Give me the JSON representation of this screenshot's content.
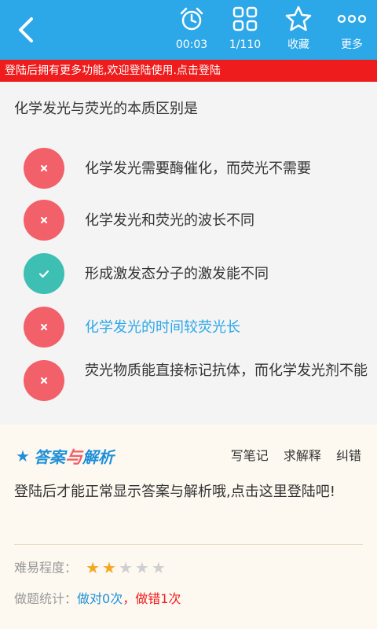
{
  "toolbar": {
    "timer": "00:03",
    "progress": "1/110",
    "favorite_label": "收藏",
    "more_label": "更多"
  },
  "banner": {
    "text": "登陆后拥有更多功能,欢迎登陆使用.点击登陆"
  },
  "question": {
    "text": "化学发光与荧光的本质区别是",
    "options": [
      {
        "text": "化学发光需要酶催化，而荧光不需要",
        "state": "wrong"
      },
      {
        "text": "化学发光和荧光的波长不同",
        "state": "wrong"
      },
      {
        "text": "形成激发态分子的激发能不同",
        "state": "correct"
      },
      {
        "text": "化学发光的时间较荧光长",
        "state": "selected"
      },
      {
        "text": "荧光物质能直接标记抗体，而化学发光剂不能",
        "state": "wrong"
      }
    ]
  },
  "answer": {
    "title_part1": "答案",
    "title_part2": "与",
    "title_part3": "解析",
    "actions": [
      "写笔记",
      "求解释",
      "纠错"
    ],
    "message": "登陆后才能正常显示答案与解析哦,点击这里登陆吧!",
    "difficulty_label": "难易程度：",
    "difficulty_stars": 2,
    "difficulty_max": 5,
    "stats_label": "做题统计：",
    "stats_right": "做对0次",
    "stats_sep": "，",
    "stats_wrong": "做错1次"
  },
  "colors": {
    "accent": "#2ca7e8",
    "banner": "#ee1c1c",
    "wrong": "#f26069",
    "correct": "#3dbfb3",
    "star_on": "#f5a623"
  }
}
